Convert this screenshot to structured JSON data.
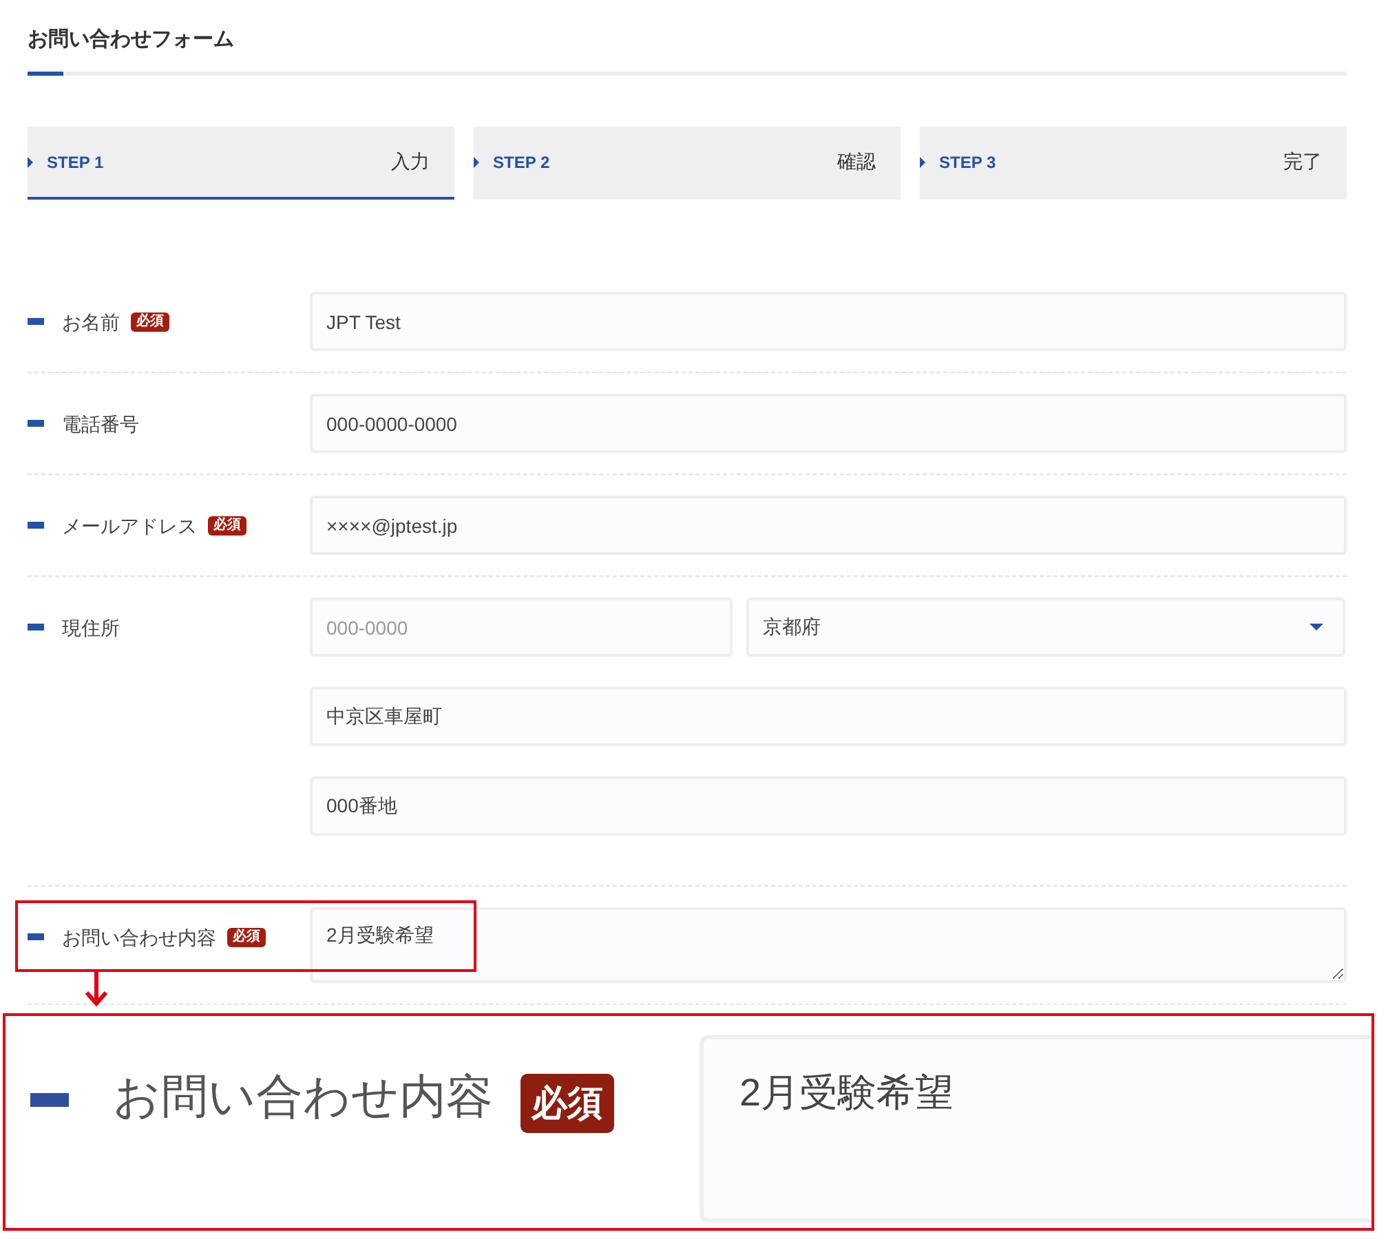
{
  "title": "お問い合わせフォーム",
  "steps": [
    {
      "step": "STEP 1",
      "label": "入力",
      "selected": true
    },
    {
      "step": "STEP 2",
      "label": "確認",
      "selected": false
    },
    {
      "step": "STEP 3",
      "label": "完了",
      "selected": false
    }
  ],
  "fields": [
    {
      "label": "お名前",
      "required": true,
      "badge": "必須",
      "inputs": [
        {
          "kind": "text",
          "value": "JPT Test"
        }
      ]
    },
    {
      "label": "電話番号",
      "required": false,
      "inputs": [
        {
          "kind": "text",
          "value": "000-0000-0000"
        }
      ]
    },
    {
      "label": "メールアドレス",
      "required": true,
      "badge": "必須",
      "inputs": [
        {
          "kind": "text",
          "value": "××××@jptest.jp"
        }
      ]
    },
    {
      "label": "現住所",
      "required": false,
      "inputs": [
        {
          "kind": "postal",
          "placeholder": "000-0000"
        },
        {
          "kind": "select",
          "value": "京都府"
        },
        {
          "kind": "text",
          "value": "中京区車屋町"
        },
        {
          "kind": "text",
          "value": "000番地"
        }
      ]
    },
    {
      "label": "お問い合わせ内容",
      "required": true,
      "badge": "必須",
      "highlighted": true,
      "inputs": [
        {
          "kind": "textarea",
          "value": "2月受験希望"
        }
      ]
    }
  ],
  "callout": {
    "label": "お問い合わせ内容",
    "badge": "必須",
    "value": "2月受験希望"
  }
}
